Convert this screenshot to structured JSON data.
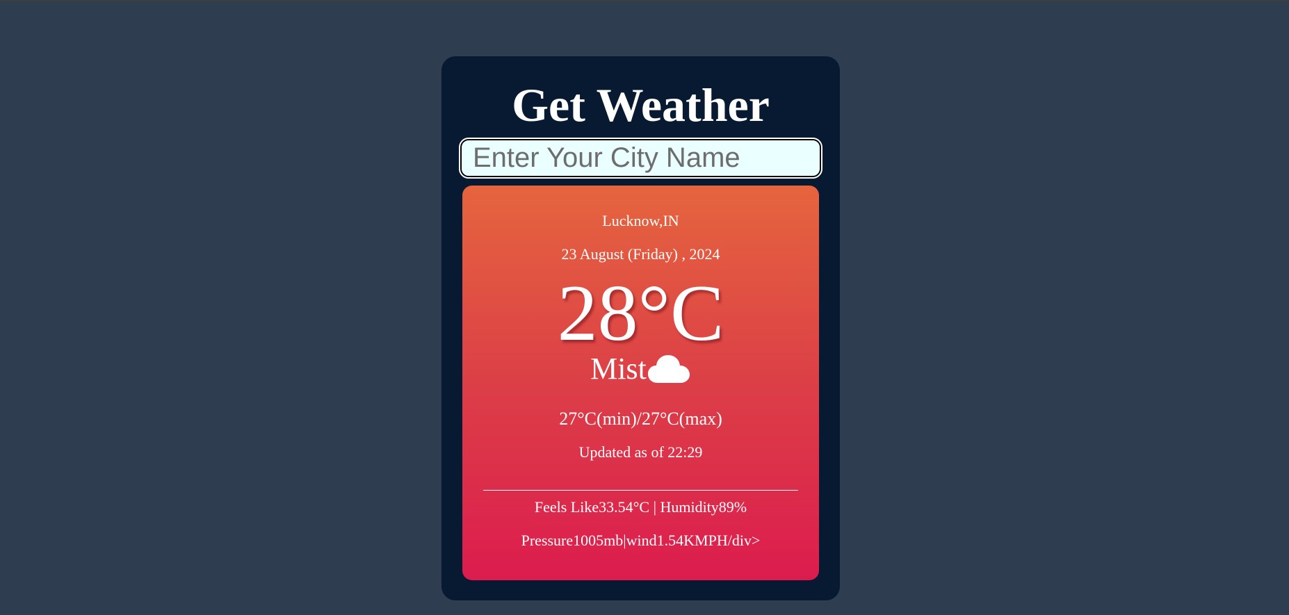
{
  "app": {
    "title": "Get Weather"
  },
  "search": {
    "placeholder": "Enter Your City Name",
    "value": ""
  },
  "weather": {
    "location": "Lucknow,IN",
    "date": "23 August (Friday) , 2024",
    "temperature": "28°C",
    "condition": "Mist",
    "condition_icon": "cloud-icon",
    "min_max": "27°C(min)/27°C(max)",
    "updated": "Updated as of 22:29",
    "feels_humidity": "Feels Like33.54°C | Humidity89%",
    "pressure_wind": "Pressure1005mb|wind1.54KMPH/div>"
  },
  "colors": {
    "page_background": "#2e3e50",
    "card_background": "#081a31",
    "input_background": "#eaffff",
    "panel_gradient_top": "#e5653e",
    "panel_gradient_bottom": "#dc1c4e",
    "text": "#ffffff"
  }
}
